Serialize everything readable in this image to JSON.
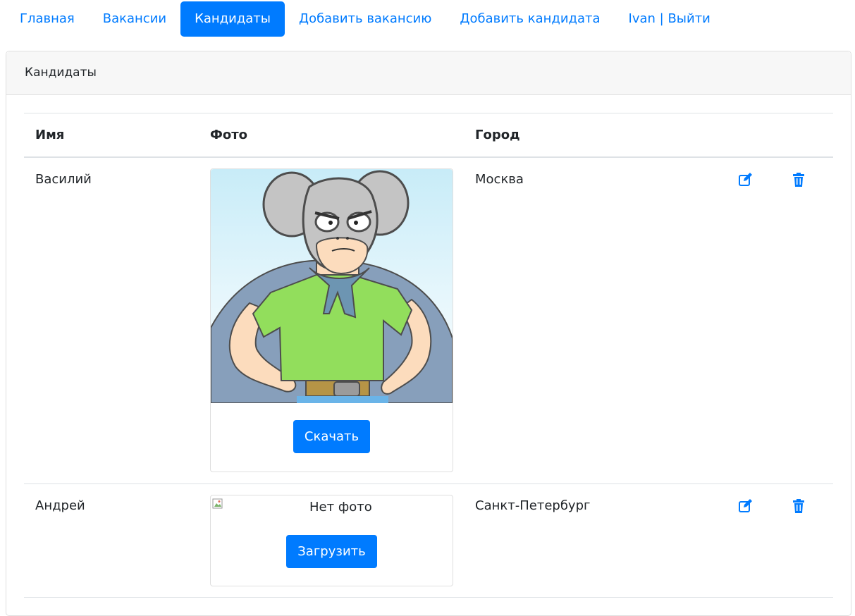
{
  "nav": {
    "items": [
      {
        "label": "Главная",
        "active": false
      },
      {
        "label": "Вакансии",
        "active": false
      },
      {
        "label": "Кандидаты",
        "active": true
      },
      {
        "label": "Добавить вакансию",
        "active": false
      },
      {
        "label": "Добавить кандидата",
        "active": false
      },
      {
        "label": "Ivan | Выйти",
        "active": false
      }
    ]
  },
  "card": {
    "title": "Кандидаты"
  },
  "table": {
    "headers": {
      "name": "Имя",
      "photo": "Фото",
      "city": "Город"
    },
    "rows": [
      {
        "name": "Василий",
        "city": "Москва",
        "photo": {
          "has_image": true,
          "button": "Скачать"
        }
      },
      {
        "name": "Андрей",
        "city": "Санкт-Петербург",
        "photo": {
          "has_image": false,
          "alt": "Нет фото",
          "button": "Загрузить"
        }
      }
    ]
  },
  "icons": {
    "edit": "edit-icon",
    "delete": "trash-icon"
  },
  "colors": {
    "accent": "#007bff"
  }
}
